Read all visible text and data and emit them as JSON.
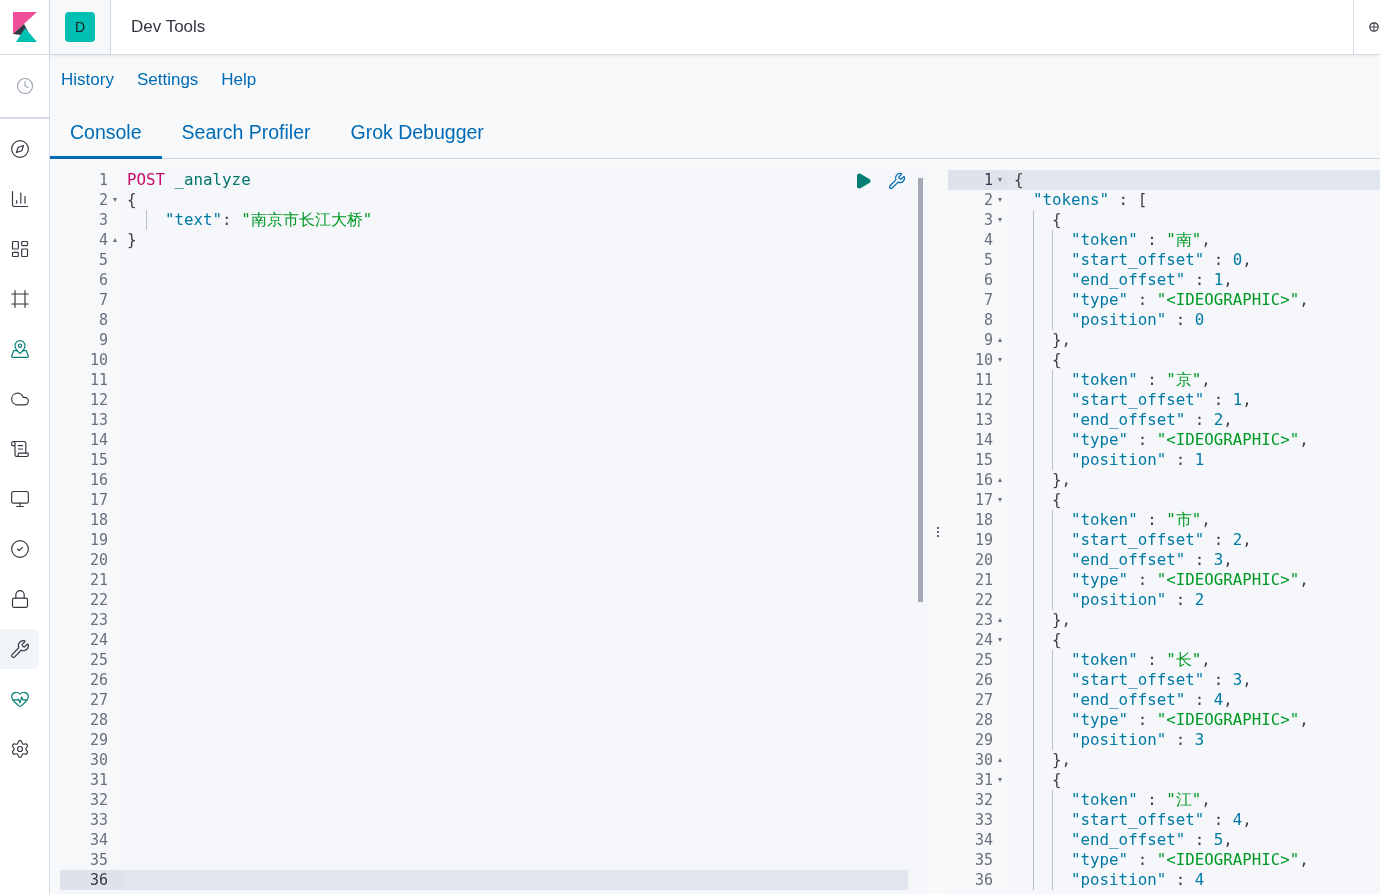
{
  "header": {
    "avatar": "D",
    "title": "Dev Tools"
  },
  "sidebar": {
    "items": [
      {
        "selected": false
      },
      {
        "selected": false
      },
      {
        "selected": false
      },
      {
        "selected": false
      },
      {
        "selected": false
      },
      {
        "selected": false
      },
      {
        "selected": false
      },
      {
        "selected": false
      },
      {
        "selected": false
      },
      {
        "selected": false
      },
      {
        "selected": true
      },
      {
        "selected": false
      },
      {
        "selected": false
      }
    ]
  },
  "menu": [
    "History",
    "Settings",
    "Help"
  ],
  "tabs": [
    {
      "label": "Console",
      "selected": true
    },
    {
      "label": "Search Profiler",
      "selected": false
    },
    {
      "label": "Grok Debugger",
      "selected": false
    }
  ],
  "request_editor": {
    "lines": [
      {
        "number": "1",
        "active": false,
        "segments": [
          {
            "kind": "method",
            "text": "POST"
          },
          {
            "kind": "url",
            "text": " _analyze"
          }
        ]
      },
      {
        "number": "2",
        "active": false,
        "fold": "▾",
        "segments": [
          {
            "kind": "punct",
            "text": "{"
          }
        ]
      },
      {
        "number": "3",
        "active": false,
        "segments": [
          {
            "kind": "key",
            "text": "    \"text\""
          },
          {
            "kind": "punct",
            "text": ": "
          },
          {
            "kind": "string",
            "text": "\"南京市长江大桥\""
          }
        ]
      },
      {
        "number": "4",
        "active": false,
        "fold": "▴",
        "segments": [
          {
            "kind": "punct",
            "text": "}"
          }
        ]
      },
      {
        "number": "5",
        "active": false
      },
      {
        "number": "6",
        "active": false
      },
      {
        "number": "7",
        "active": false
      },
      {
        "number": "8",
        "active": false
      },
      {
        "number": "9",
        "active": false
      },
      {
        "number": "10",
        "active": false
      },
      {
        "number": "11",
        "active": false
      },
      {
        "number": "12",
        "active": false
      },
      {
        "number": "13",
        "active": false
      },
      {
        "number": "14",
        "active": false
      },
      {
        "number": "15",
        "active": false
      },
      {
        "number": "16",
        "active": false
      },
      {
        "number": "17",
        "active": false
      },
      {
        "number": "18",
        "active": false
      },
      {
        "number": "19",
        "active": false
      },
      {
        "number": "20",
        "active": false
      },
      {
        "number": "21",
        "active": false
      },
      {
        "number": "22",
        "active": false
      },
      {
        "number": "23",
        "active": false
      },
      {
        "number": "24",
        "active": false
      },
      {
        "number": "25",
        "active": false
      },
      {
        "number": "26",
        "active": false
      },
      {
        "number": "27",
        "active": false
      },
      {
        "number": "28",
        "active": false
      },
      {
        "number": "29",
        "active": false
      },
      {
        "number": "30",
        "active": false
      },
      {
        "number": "31",
        "active": false
      },
      {
        "number": "32",
        "active": false
      },
      {
        "number": "33",
        "active": false
      },
      {
        "number": "34",
        "active": false
      },
      {
        "number": "35",
        "active": false
      },
      {
        "number": "36",
        "active": true
      }
    ]
  },
  "response_panel": {
    "lines": [
      {
        "number": "1",
        "active": true,
        "fold": "▾",
        "segments": [
          {
            "kind": "punct",
            "text": "{"
          }
        ]
      },
      {
        "number": "2",
        "active": false,
        "fold": "▾",
        "segments": [
          {
            "kind": "key",
            "text": "  \"tokens\""
          },
          {
            "kind": "punct",
            "text": " : ["
          }
        ]
      },
      {
        "number": "3",
        "active": false,
        "fold": "▾",
        "segments": [
          {
            "kind": "punct",
            "text": "    {"
          }
        ]
      },
      {
        "number": "4",
        "active": false,
        "segments": [
          {
            "kind": "key",
            "text": "      \"token\""
          },
          {
            "kind": "punct",
            "text": " : "
          },
          {
            "kind": "string",
            "text": "\"南\""
          },
          {
            "kind": "punct",
            "text": ","
          }
        ]
      },
      {
        "number": "5",
        "active": false,
        "segments": [
          {
            "kind": "key",
            "text": "      \"start_offset\""
          },
          {
            "kind": "punct",
            "text": " : "
          },
          {
            "kind": "number",
            "text": "0"
          },
          {
            "kind": "punct",
            "text": ","
          }
        ]
      },
      {
        "number": "6",
        "active": false,
        "segments": [
          {
            "kind": "key",
            "text": "      \"end_offset\""
          },
          {
            "kind": "punct",
            "text": " : "
          },
          {
            "kind": "number",
            "text": "1"
          },
          {
            "kind": "punct",
            "text": ","
          }
        ]
      },
      {
        "number": "7",
        "active": false,
        "segments": [
          {
            "kind": "key",
            "text": "      \"type\""
          },
          {
            "kind": "punct",
            "text": " : "
          },
          {
            "kind": "string",
            "text": "\"<IDEOGRAPHIC>\""
          },
          {
            "kind": "punct",
            "text": ","
          }
        ]
      },
      {
        "number": "8",
        "active": false,
        "segments": [
          {
            "kind": "key",
            "text": "      \"position\""
          },
          {
            "kind": "punct",
            "text": " : "
          },
          {
            "kind": "number",
            "text": "0"
          }
        ]
      },
      {
        "number": "9",
        "active": false,
        "fold": "▴",
        "segments": [
          {
            "kind": "punct",
            "text": "    },"
          }
        ]
      },
      {
        "number": "10",
        "active": false,
        "fold": "▾",
        "segments": [
          {
            "kind": "punct",
            "text": "    {"
          }
        ]
      },
      {
        "number": "11",
        "active": false,
        "segments": [
          {
            "kind": "key",
            "text": "      \"token\""
          },
          {
            "kind": "punct",
            "text": " : "
          },
          {
            "kind": "string",
            "text": "\"京\""
          },
          {
            "kind": "punct",
            "text": ","
          }
        ]
      },
      {
        "number": "12",
        "active": false,
        "segments": [
          {
            "kind": "key",
            "text": "      \"start_offset\""
          },
          {
            "kind": "punct",
            "text": " : "
          },
          {
            "kind": "number",
            "text": "1"
          },
          {
            "kind": "punct",
            "text": ","
          }
        ]
      },
      {
        "number": "13",
        "active": false,
        "segments": [
          {
            "kind": "key",
            "text": "      \"end_offset\""
          },
          {
            "kind": "punct",
            "text": " : "
          },
          {
            "kind": "number",
            "text": "2"
          },
          {
            "kind": "punct",
            "text": ","
          }
        ]
      },
      {
        "number": "14",
        "active": false,
        "segments": [
          {
            "kind": "key",
            "text": "      \"type\""
          },
          {
            "kind": "punct",
            "text": " : "
          },
          {
            "kind": "string",
            "text": "\"<IDEOGRAPHIC>\""
          },
          {
            "kind": "punct",
            "text": ","
          }
        ]
      },
      {
        "number": "15",
        "active": false,
        "segments": [
          {
            "kind": "key",
            "text": "      \"position\""
          },
          {
            "kind": "punct",
            "text": " : "
          },
          {
            "kind": "number",
            "text": "1"
          }
        ]
      },
      {
        "number": "16",
        "active": false,
        "fold": "▴",
        "segments": [
          {
            "kind": "punct",
            "text": "    },"
          }
        ]
      },
      {
        "number": "17",
        "active": false,
        "fold": "▾",
        "segments": [
          {
            "kind": "punct",
            "text": "    {"
          }
        ]
      },
      {
        "number": "18",
        "active": false,
        "segments": [
          {
            "kind": "key",
            "text": "      \"token\""
          },
          {
            "kind": "punct",
            "text": " : "
          },
          {
            "kind": "string",
            "text": "\"市\""
          },
          {
            "kind": "punct",
            "text": ","
          }
        ]
      },
      {
        "number": "19",
        "active": false,
        "segments": [
          {
            "kind": "key",
            "text": "      \"start_offset\""
          },
          {
            "kind": "punct",
            "text": " : "
          },
          {
            "kind": "number",
            "text": "2"
          },
          {
            "kind": "punct",
            "text": ","
          }
        ]
      },
      {
        "number": "20",
        "active": false,
        "segments": [
          {
            "kind": "key",
            "text": "      \"end_offset\""
          },
          {
            "kind": "punct",
            "text": " : "
          },
          {
            "kind": "number",
            "text": "3"
          },
          {
            "kind": "punct",
            "text": ","
          }
        ]
      },
      {
        "number": "21",
        "active": false,
        "segments": [
          {
            "kind": "key",
            "text": "      \"type\""
          },
          {
            "kind": "punct",
            "text": " : "
          },
          {
            "kind": "string",
            "text": "\"<IDEOGRAPHIC>\""
          },
          {
            "kind": "punct",
            "text": ","
          }
        ]
      },
      {
        "number": "22",
        "active": false,
        "segments": [
          {
            "kind": "key",
            "text": "      \"position\""
          },
          {
            "kind": "punct",
            "text": " : "
          },
          {
            "kind": "number",
            "text": "2"
          }
        ]
      },
      {
        "number": "23",
        "active": false,
        "fold": "▴",
        "segments": [
          {
            "kind": "punct",
            "text": "    },"
          }
        ]
      },
      {
        "number": "24",
        "active": false,
        "fold": "▾",
        "segments": [
          {
            "kind": "punct",
            "text": "    {"
          }
        ]
      },
      {
        "number": "25",
        "active": false,
        "segments": [
          {
            "kind": "key",
            "text": "      \"token\""
          },
          {
            "kind": "punct",
            "text": " : "
          },
          {
            "kind": "string",
            "text": "\"长\""
          },
          {
            "kind": "punct",
            "text": ","
          }
        ]
      },
      {
        "number": "26",
        "active": false,
        "segments": [
          {
            "kind": "key",
            "text": "      \"start_offset\""
          },
          {
            "kind": "punct",
            "text": " : "
          },
          {
            "kind": "number",
            "text": "3"
          },
          {
            "kind": "punct",
            "text": ","
          }
        ]
      },
      {
        "number": "27",
        "active": false,
        "segments": [
          {
            "kind": "key",
            "text": "      \"end_offset\""
          },
          {
            "kind": "punct",
            "text": " : "
          },
          {
            "kind": "number",
            "text": "4"
          },
          {
            "kind": "punct",
            "text": ","
          }
        ]
      },
      {
        "number": "28",
        "active": false,
        "segments": [
          {
            "kind": "key",
            "text": "      \"type\""
          },
          {
            "kind": "punct",
            "text": " : "
          },
          {
            "kind": "string",
            "text": "\"<IDEOGRAPHIC>\""
          },
          {
            "kind": "punct",
            "text": ","
          }
        ]
      },
      {
        "number": "29",
        "active": false,
        "segments": [
          {
            "kind": "key",
            "text": "      \"position\""
          },
          {
            "kind": "punct",
            "text": " : "
          },
          {
            "kind": "number",
            "text": "3"
          }
        ]
      },
      {
        "number": "30",
        "active": false,
        "fold": "▴",
        "segments": [
          {
            "kind": "punct",
            "text": "    },"
          }
        ]
      },
      {
        "number": "31",
        "active": false,
        "fold": "▾",
        "segments": [
          {
            "kind": "punct",
            "text": "    {"
          }
        ]
      },
      {
        "number": "32",
        "active": false,
        "segments": [
          {
            "kind": "key",
            "text": "      \"token\""
          },
          {
            "kind": "punct",
            "text": " : "
          },
          {
            "kind": "string",
            "text": "\"江\""
          },
          {
            "kind": "punct",
            "text": ","
          }
        ]
      },
      {
        "number": "33",
        "active": false,
        "segments": [
          {
            "kind": "key",
            "text": "      \"start_offset\""
          },
          {
            "kind": "punct",
            "text": " : "
          },
          {
            "kind": "number",
            "text": "4"
          },
          {
            "kind": "punct",
            "text": ","
          }
        ]
      },
      {
        "number": "34",
        "active": false,
        "segments": [
          {
            "kind": "key",
            "text": "      \"end_offset\""
          },
          {
            "kind": "punct",
            "text": " : "
          },
          {
            "kind": "number",
            "text": "5"
          },
          {
            "kind": "punct",
            "text": ","
          }
        ]
      },
      {
        "number": "35",
        "active": false,
        "segments": [
          {
            "kind": "key",
            "text": "      \"type\""
          },
          {
            "kind": "punct",
            "text": " : "
          },
          {
            "kind": "string",
            "text": "\"<IDEOGRAPHIC>\""
          },
          {
            "kind": "punct",
            "text": ","
          }
        ]
      },
      {
        "number": "36",
        "active": false,
        "segments": [
          {
            "kind": "key",
            "text": "      \"position\""
          },
          {
            "kind": "punct",
            "text": " : "
          },
          {
            "kind": "number",
            "text": "4"
          }
        ]
      }
    ]
  }
}
